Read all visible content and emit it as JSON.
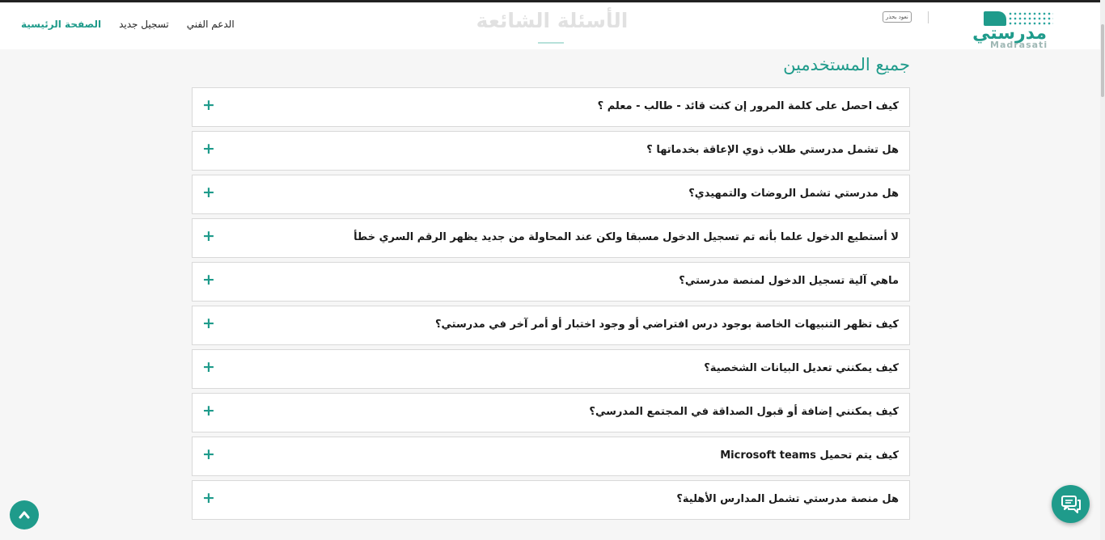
{
  "nav": {
    "home": "الصفحة الرئيسية",
    "register": "تسجيل جديد",
    "support": "الدعم الفني"
  },
  "page_title": "الأسئلة الشائعة",
  "back_badge": "نعود بحذر",
  "logo": {
    "arabic": "مدرستي",
    "english": "Madrasati"
  },
  "section_title": "جميع المستخدمين",
  "faqs": [
    "كيف احصل على كلمة المرور إن كنت قائد - طالب - معلم ؟",
    "هل تشمل مدرستي طلاب ذوي الإعاقة بخدماتها ؟",
    "هل مدرستي تشمل الروضات والتمهيدي؟",
    "لا أستطيع الدخول علما بأنه تم تسجيل الدخول مسبقا ولكن عند المحاولة من جديد يظهر الرقم السري خطأ",
    "ماهي آلية تسجيل الدخول لمنصة مدرستي؟",
    "كيف تظهر التنبيهات الخاصة بوجود درس افتراضي أو وجود اختبار أو أمر آخر في مدرستي؟",
    "كيف يمكنني تعديل البيانات الشخصية؟",
    "كيف يمكنني إضافة أو قبول الصداقة في المجتمع المدرسي؟",
    "كيف يتم تحميل Microsoft teams",
    "هل منصة مدرستي تشمل المدارس الأهلية؟"
  ],
  "expand_symbol": "+",
  "colors": {
    "accent": "#1f9b8b",
    "title_faded": "#e1e1e1"
  },
  "icons": {
    "scroll_top": "chevron-up-icon",
    "chat": "chat-bubbles-icon"
  }
}
